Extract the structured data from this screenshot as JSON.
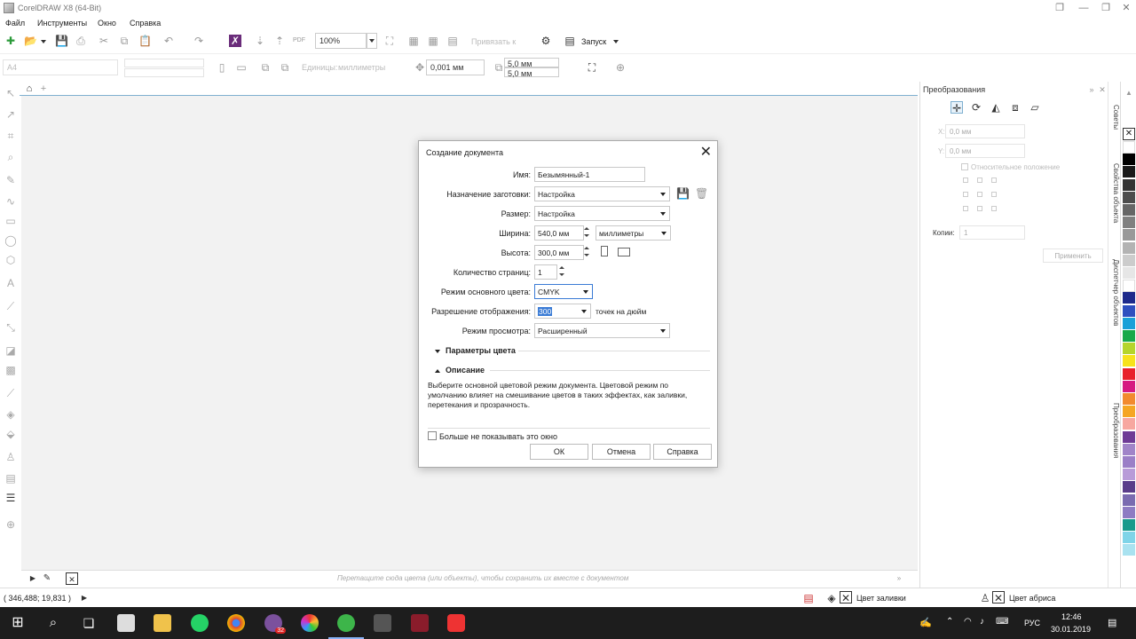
{
  "window": {
    "title": "CorelDRAW X8 (64-Bit)"
  },
  "menu": {
    "items": [
      "Файл",
      "Инструменты",
      "Окно",
      "Справка"
    ]
  },
  "toolbar1": {
    "zoom": "100%",
    "snap_label": "Привязать к",
    "launch_label": "Запуск"
  },
  "toolbar2": {
    "page_size": "А4",
    "units_label": "Единицы:",
    "units_value": "миллиметры",
    "nudge": "0,001 мм",
    "dup_x": "5,0 мм",
    "dup_y": "5,0 мм"
  },
  "docker": {
    "title": "Преобразования",
    "x_label": "X:",
    "x_value": "0,0 мм",
    "y_label": "Y:",
    "y_value": "0,0 мм",
    "relative_label": "Относительное положение",
    "copies_label": "Копии:",
    "copies_value": "1",
    "apply_label": "Применить"
  },
  "side_tabs": [
    "Советы",
    "Свойства объекта",
    "Диспетчер объектов",
    "Преобразования"
  ],
  "palette": [
    "#ffffff",
    "#000000",
    "#1a1a1a",
    "#333333",
    "#4d4d4d",
    "#666666",
    "#808080",
    "#999999",
    "#b3b3b3",
    "#cccccc",
    "#e6e6e6",
    "#ffffff",
    "#1e2a8c",
    "#2f4fbf",
    "#1aa0d8",
    "#19a94a",
    "#b5d52b",
    "#f7e21b",
    "#e8212b",
    "#d61b82",
    "#f28a2e",
    "#f5a623",
    "#f7a7a0",
    "#6e3b96",
    "#a084c8",
    "#9b7fc7",
    "#b89bd8",
    "#5a3d8a",
    "#7a6bb0",
    "#8e7cc3",
    "#1a9a8c",
    "#7fd4e8",
    "#a9e2f0"
  ],
  "pagebar": {
    "hint": "Перетащите сюда цвета (или объекты), чтобы сохранить их вместе с документом"
  },
  "status": {
    "coords": "( 346,488; 19,831 )",
    "fill_label": "Цвет заливки",
    "outline_label": "Цвет абриса"
  },
  "taskbar": {
    "lang": "РУС",
    "time": "12:46",
    "date": "30.01.2019",
    "badge": "32"
  },
  "dialog": {
    "title": "Создание документа",
    "name_label": "Имя:",
    "name_value": "Безымянный-1",
    "preset_label": "Назначение заготовки:",
    "preset_value": "Настройка",
    "size_label": "Размер:",
    "size_value": "Настройка",
    "width_label": "Ширина:",
    "width_value": "540,0 мм",
    "units_value": "миллиметры",
    "height_label": "Высота:",
    "height_value": "300,0 мм",
    "pages_label": "Количество страниц:",
    "pages_value": "1",
    "color_mode_label": "Режим основного цвета:",
    "color_mode_value": "CMYK",
    "resolution_label": "Разрешение отображения:",
    "resolution_value": "300",
    "resolution_unit": "точек на дюйм",
    "view_mode_label": "Режим просмотра:",
    "view_mode_value": "Расширенный",
    "color_params_label": "Параметры цвета",
    "description_label": "Описание",
    "description_text": "Выберите основной цветовой режим документа. Цветовой режим по умолчанию влияет на смешивание цветов в таких эффектах, как заливки, перетекания и прозрачность.",
    "dont_show_label": "Больше не показывать это окно",
    "ok_label": "ОК",
    "cancel_label": "Отмена",
    "help_label": "Справка"
  }
}
